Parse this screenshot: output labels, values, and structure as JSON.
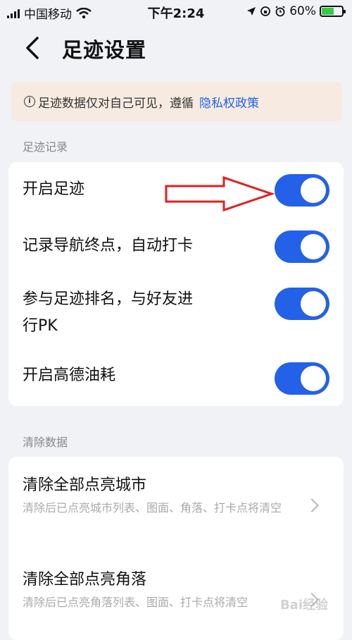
{
  "status": {
    "carrier": "中国移动",
    "time": "下午2:24",
    "battery": "60%",
    "battery_level": 0.6
  },
  "header": {
    "title": "足迹设置"
  },
  "notice": {
    "text": "足迹数据仅对自己可见，遵循",
    "link": "隐私权政策"
  },
  "sections": {
    "record_label": "足迹记录",
    "clear_label": "清除数据"
  },
  "toggles": [
    {
      "label": "开启足迹",
      "on": true
    },
    {
      "label": "记录导航终点，自动打卡",
      "on": true
    },
    {
      "label": "参与足迹排名，与好友进\n行PK",
      "on": true
    },
    {
      "label": "开启高德油耗",
      "on": true
    }
  ],
  "clear_items": [
    {
      "title": "清除全部点亮城市",
      "desc": "清除后已点亮城市列表、图面、角落、打卡点将清空"
    },
    {
      "title": "清除全部点亮角落",
      "desc": "清除后已点亮角落列表、图面、打卡点将清空"
    }
  ],
  "watermark": "Bai经验",
  "colors": {
    "accent": "#2361e8",
    "annotation": "#e02020",
    "notice_bg": "#f7ebe1"
  }
}
